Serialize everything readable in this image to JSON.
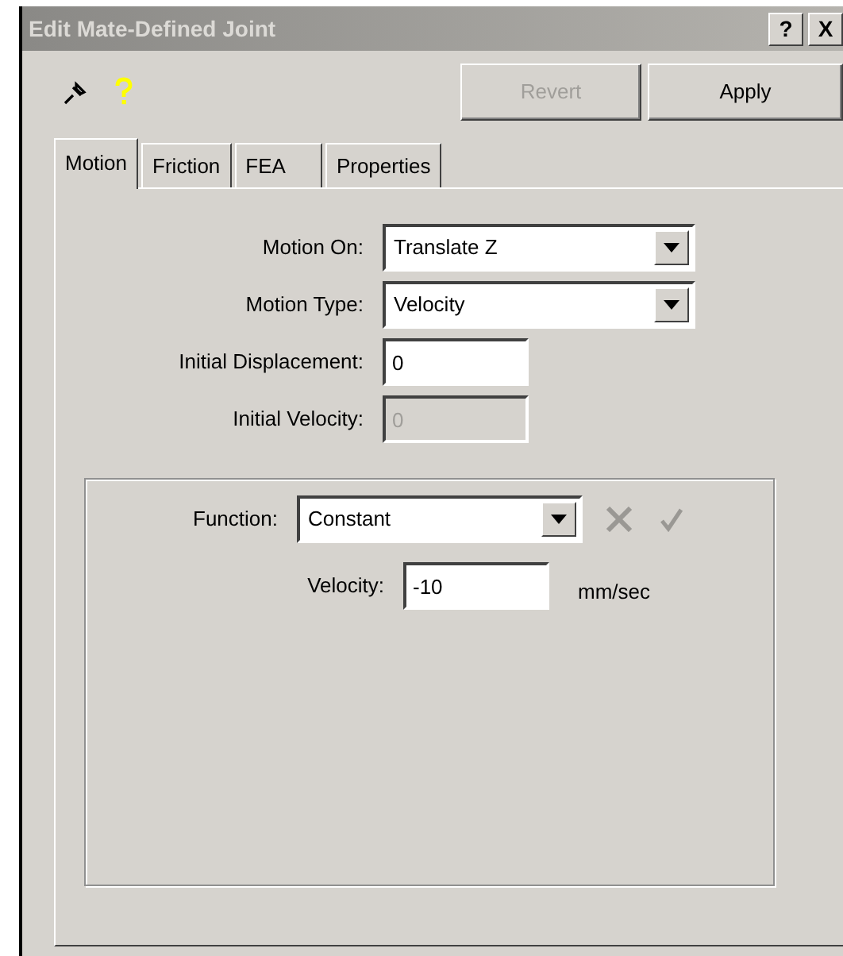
{
  "window": {
    "title": "Edit Mate-Defined Joint",
    "title_buttons": [
      "?",
      "X"
    ]
  },
  "toolbar": {
    "buttons": [
      {
        "label": "Revert",
        "disabled": true
      },
      {
        "label": "Apply",
        "disabled": false
      }
    ]
  },
  "tabs": [
    {
      "label": "Motion",
      "selected": true
    },
    {
      "label": "Friction",
      "selected": false
    },
    {
      "label": "FEA",
      "selected": false
    },
    {
      "label": "Properties",
      "selected": false
    }
  ],
  "fields": [
    {
      "label": "Motion On:",
      "kind": "select",
      "value": "Translate Z",
      "disabled": false
    },
    {
      "label": "Motion Type:",
      "kind": "select",
      "value": "Velocity",
      "disabled": false
    },
    {
      "label": "Initial Displacement:",
      "kind": "text",
      "value": "0",
      "disabled": false
    },
    {
      "label": "Initial Velocity:",
      "kind": "text",
      "value": "0",
      "disabled": true
    }
  ],
  "function_group": {
    "function": {
      "label": "Function:",
      "value": "Constant"
    },
    "actions": [
      {
        "kind": "cancel",
        "disabled": true
      },
      {
        "kind": "accept",
        "disabled": true
      }
    ],
    "velocity": {
      "label": "Velocity:",
      "value": "-10",
      "unit": "mm/sec"
    }
  }
}
